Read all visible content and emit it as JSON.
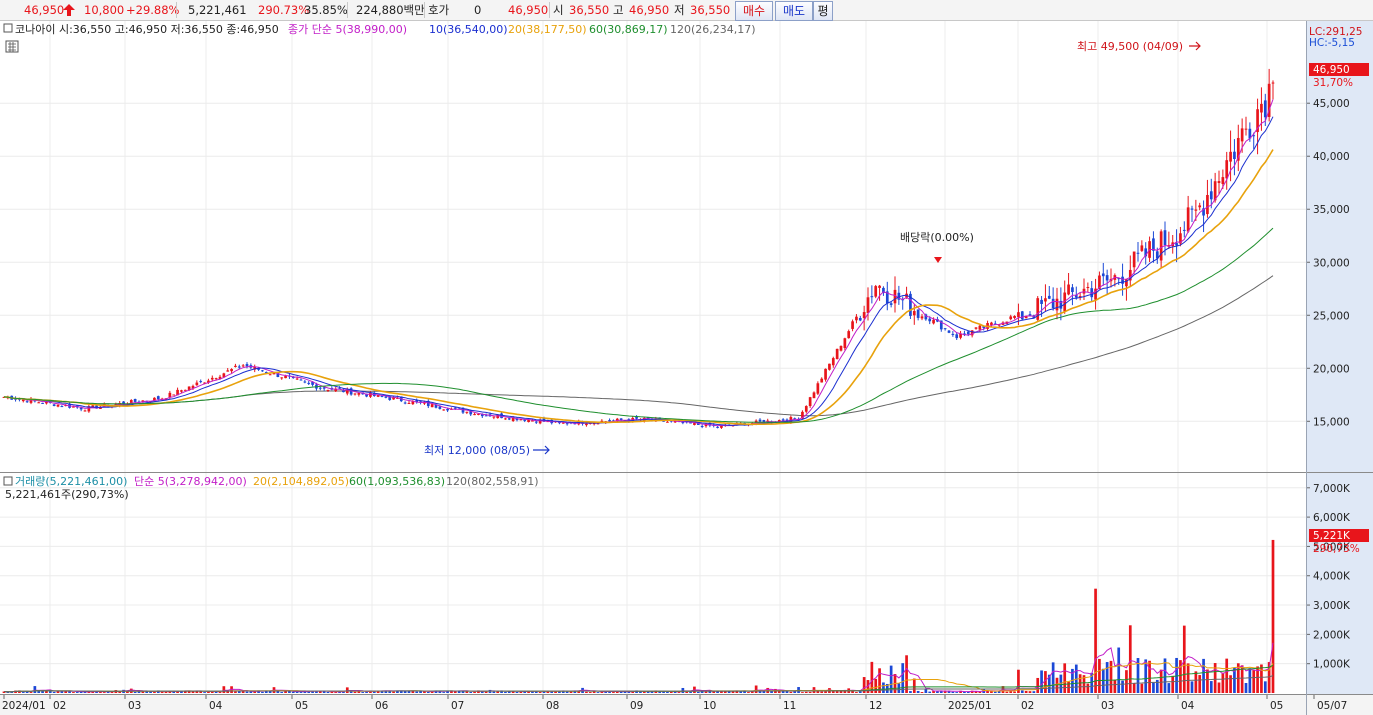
{
  "quote_bar": {
    "price": "46,950",
    "change": "10,800",
    "change_pct": "+29.88%",
    "volume": "5,221,461",
    "volume_ratio": "290.73%",
    "turnover_pct": "35.85%",
    "trade_value": "224,880백만",
    "hoga_label": "호가",
    "hoga_value": "0",
    "hoga_price": "46,950",
    "open_label": "시",
    "open": "36,550",
    "high_label": "고",
    "high": "46,950",
    "low_label": "저",
    "low": "36,550",
    "buy_label": "매수",
    "sell_label": "매도",
    "flat_label": "평"
  },
  "price_panel": {
    "info": "코나아이 시:36,550 고:46,950 저:36,550 종:46,950",
    "ma_legend": [
      {
        "label": "종가 단순 5(38,990,00)",
        "color": "#c21ec8"
      },
      {
        "label": "10(36,540,00)",
        "color": "#1b2fd0"
      },
      {
        "label": "20(38,177,50)",
        "color": "#e8a20c"
      },
      {
        "label": "60(30,869,17)",
        "color": "#1f8f2e"
      },
      {
        "label": "120(26,234,17)",
        "color": "#666666"
      }
    ],
    "lc": "LC:291,25",
    "hc": "HC:-5,15",
    "last_price_tag": "46,950",
    "last_pct_tag": "31,70%",
    "high_annotation": "최고 49,500 (04/09)",
    "low_annotation": "최저 12,000 (08/05)",
    "ex_div_annotation": "배당락(0.00%)"
  },
  "volume_panel": {
    "legend": [
      {
        "label": "거래량(5,221,461,00)",
        "color": "#1c8fa6"
      },
      {
        "label": "단순 5(3,278,942,00)",
        "color": "#c21ec8"
      },
      {
        "label": "20(2,104,892,05)",
        "color": "#e8a20c"
      },
      {
        "label": "60(1,093,536,83)",
        "color": "#1f8f2e"
      },
      {
        "label": "120(802,558,91)",
        "color": "#666666"
      }
    ],
    "info": "5,221,461주(290,73%)",
    "last_volume_tag": "5,221K",
    "last_pct_tag": "290,73%"
  },
  "colors": {
    "up": "#e8151b",
    "down": "#1b48d6",
    "grid": "#ececec",
    "axis_bg": "#dfe8f6"
  },
  "chart_data": [
    {
      "type": "candlestick",
      "title": "코나아이",
      "y_ticks": [
        15000,
        20000,
        25000,
        30000,
        35000,
        40000,
        45000
      ],
      "y_tick_labels": [
        "15,000",
        "20,000",
        "25,000",
        "30,000",
        "35,000",
        "40,000",
        "45,000"
      ],
      "ylim": [
        10500,
        52000
      ],
      "x_tick_labels": [
        "2024/01",
        "02",
        "03",
        "04",
        "05",
        "06",
        "07",
        "08",
        "09",
        "10",
        "11",
        "12",
        "2025/01",
        "02",
        "03",
        "04",
        "05",
        "05/07"
      ],
      "key_points": [
        {
          "month": "2024/01",
          "close": 17300
        },
        {
          "month": "2024/02",
          "close": 16200
        },
        {
          "month": "2024/03",
          "close": 17200
        },
        {
          "month": "2024/04",
          "close": 20300
        },
        {
          "month": "2024/05",
          "close": 18200
        },
        {
          "month": "2024/06",
          "close": 17000
        },
        {
          "month": "2024/07",
          "close": 15700
        },
        {
          "month": "2024/08",
          "close": 14800
        },
        {
          "month": "2024/09",
          "close": 15200
        },
        {
          "month": "2024/10",
          "close": 14500
        },
        {
          "month": "2024/11",
          "close": 15300
        },
        {
          "month": "2024/12",
          "close": 28000
        },
        {
          "month": "2025/01",
          "close": 23000
        },
        {
          "month": "2025/02",
          "close": 25500
        },
        {
          "month": "2025/03",
          "close": 28500
        },
        {
          "month": "2025/04",
          "close": 34000
        },
        {
          "month": "2025/05",
          "close": 46950
        }
      ],
      "series": [
        {
          "name": "종가 단순 5",
          "last": 38990
        },
        {
          "name": "10",
          "last": 36540
        },
        {
          "name": "20",
          "last": 38177.5
        },
        {
          "name": "60",
          "last": 30869.17
        },
        {
          "name": "120",
          "last": 26234.17
        }
      ]
    },
    {
      "type": "bar",
      "title": "거래량",
      "y_ticks": [
        1000,
        2000,
        3000,
        4000,
        5000,
        6000,
        7000
      ],
      "y_tick_labels": [
        "1,000K",
        "2,000K",
        "3,000K",
        "4,000K",
        "5,000K",
        "6,000K",
        "7,000K"
      ],
      "ylim": [
        0,
        7300
      ],
      "unit": "K",
      "last_volume": 5221.461
    }
  ]
}
